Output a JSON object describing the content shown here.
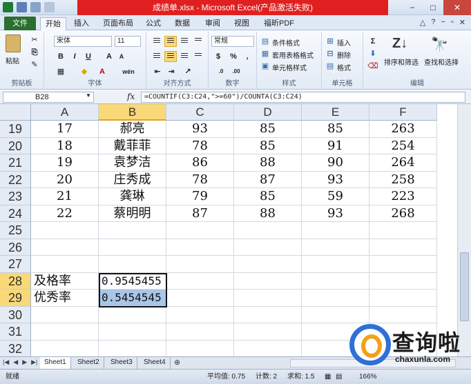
{
  "window": {
    "title": "成绩单.xlsx - Microsoft Excel(产品激活失败)",
    "controls": [
      "−",
      "□",
      "✕"
    ]
  },
  "tabs": {
    "file": "文件",
    "items": [
      "开始",
      "插入",
      "页面布局",
      "公式",
      "数据",
      "审阅",
      "视图",
      "福昕PDF"
    ]
  },
  "ribbon": {
    "clipboard": {
      "label": "剪贴板",
      "paste": "粘贴"
    },
    "font": {
      "label": "字体",
      "font_name": "宋体",
      "font_size": "11",
      "bold": "B",
      "italic": "I",
      "underline": "U",
      "grow": "A",
      "shrink": "A",
      "wen": "wén"
    },
    "alignment": {
      "label": "对齐方式"
    },
    "number": {
      "label": "数字",
      "format": "常规",
      "percent": "%",
      "comma": ","
    },
    "styles": {
      "label": "样式",
      "conditional": "条件格式",
      "table": "套用表格格式",
      "cell": "单元格样式"
    },
    "cells": {
      "label": "单元格",
      "insert": "插入",
      "delete": "删除",
      "format": "格式"
    },
    "editing": {
      "label": "编辑",
      "sort": "排序和筛选",
      "find": "查找和选择",
      "sigma": "Σ"
    }
  },
  "formula_bar": {
    "name_box": "B28",
    "fx": "fx",
    "formula": "=COUNTIF(C3:C24,\">=60\")/COUNTA(C3:C24)"
  },
  "columns": [
    "A",
    "B",
    "C",
    "D",
    "E",
    "F"
  ],
  "selected_column": "B",
  "rows": [
    {
      "num": "19",
      "cells": [
        "17",
        "郝亮",
        "93",
        "85",
        "85",
        "263"
      ]
    },
    {
      "num": "20",
      "cells": [
        "18",
        "戴菲菲",
        "78",
        "85",
        "91",
        "254"
      ]
    },
    {
      "num": "21",
      "cells": [
        "19",
        "袁梦洁",
        "86",
        "88",
        "90",
        "264"
      ]
    },
    {
      "num": "22",
      "cells": [
        "20",
        "庄秀成",
        "78",
        "87",
        "93",
        "258"
      ]
    },
    {
      "num": "23",
      "cells": [
        "21",
        "龚琳",
        "79",
        "85",
        "59",
        "223"
      ]
    },
    {
      "num": "24",
      "cells": [
        "22",
        "蔡明明",
        "87",
        "88",
        "93",
        "268"
      ]
    },
    {
      "num": "25",
      "cells": [
        "",
        "",
        "",
        "",
        "",
        ""
      ]
    },
    {
      "num": "26",
      "cells": [
        "",
        "",
        "",
        "",
        "",
        ""
      ]
    },
    {
      "num": "27",
      "cells": [
        "",
        "",
        "",
        "",
        "",
        ""
      ]
    },
    {
      "num": "28",
      "cells": [
        "及格率",
        "0.9545455",
        "",
        "",
        "",
        ""
      ]
    },
    {
      "num": "29",
      "cells": [
        "优秀率",
        "0.5454545",
        "",
        "",
        "",
        ""
      ]
    },
    {
      "num": "30",
      "cells": [
        "",
        "",
        "",
        "",
        "",
        ""
      ]
    },
    {
      "num": "31",
      "cells": [
        "",
        "",
        "",
        "",
        "",
        ""
      ]
    },
    {
      "num": "32",
      "cells": [
        "",
        "",
        "",
        "",
        "",
        ""
      ]
    }
  ],
  "sheets": [
    "Sheet1",
    "Sheet2",
    "Sheet3",
    "Sheet4"
  ],
  "active_sheet": "Sheet1",
  "status": {
    "mode": "就绪",
    "average": "平均值: 0.75",
    "count": "计数: 2",
    "sum": "求和: 1.5",
    "zoom": "166%"
  },
  "watermark": {
    "title": "查询啦",
    "subtitle": "chaxunla.com"
  },
  "colors": {
    "title_bar": "#e02020",
    "file_tab": "#2a6f2f",
    "selection_fill": "#a9c6e8",
    "header_highlight": "#f9d877"
  }
}
